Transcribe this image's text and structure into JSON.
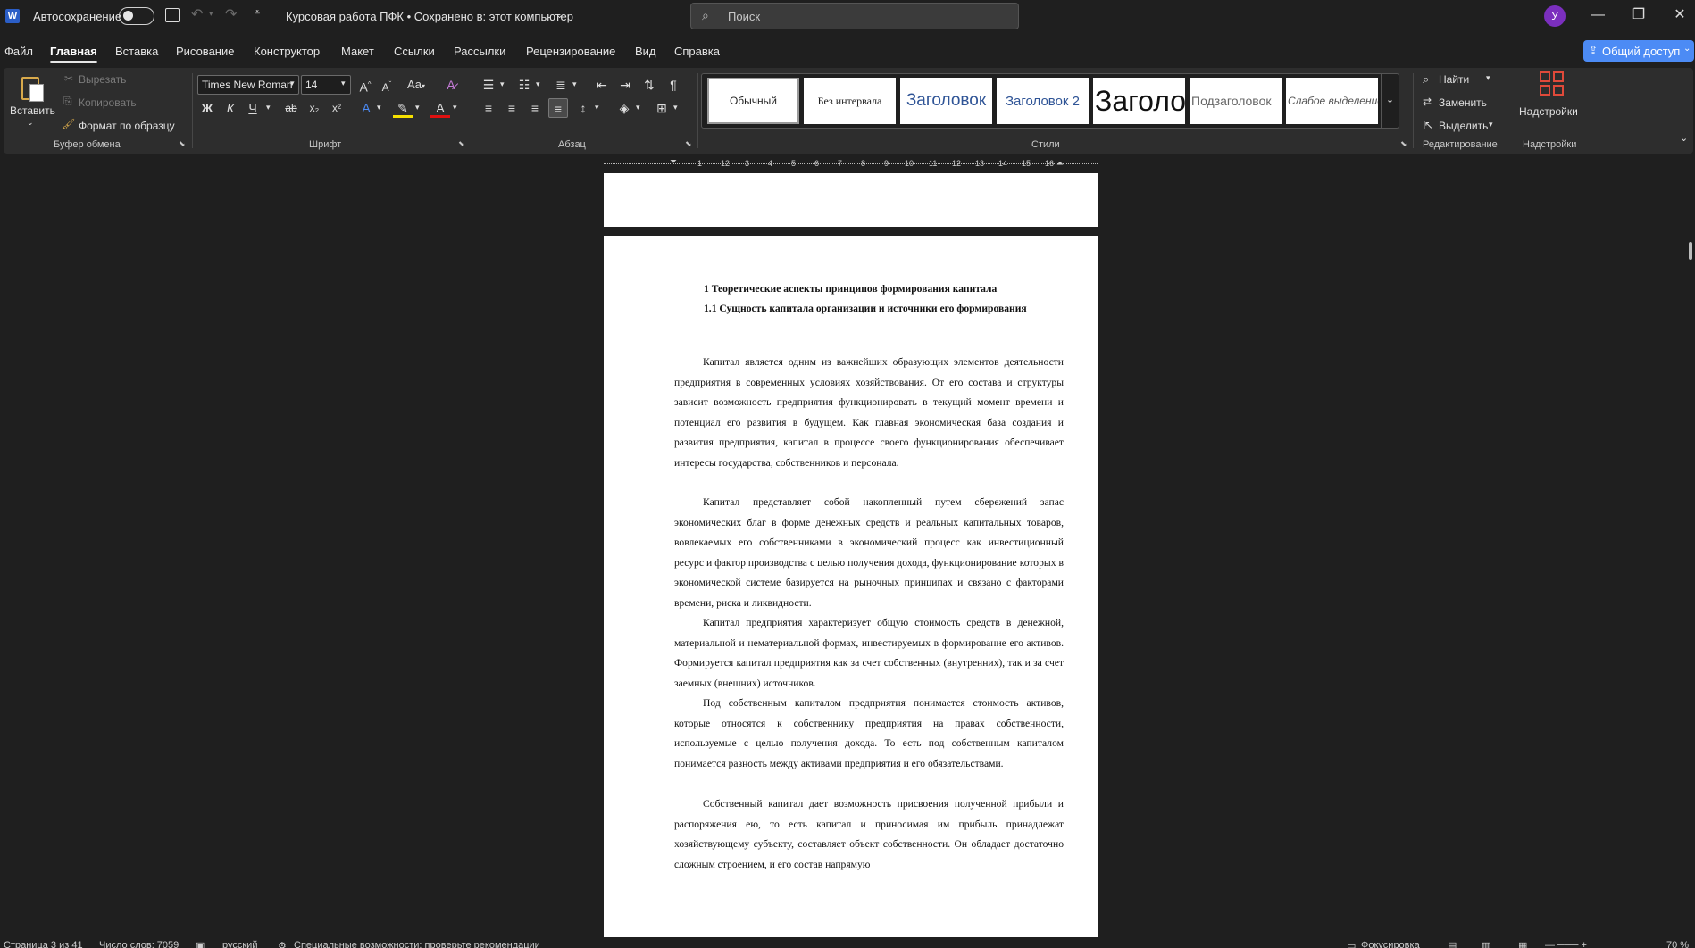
{
  "titlebar": {
    "app_icon": "word-logo-icon",
    "autosave_label": "Автосохранение",
    "document_title": "Курсовая работа ПФК • Сохранено в: этот компьютер",
    "search_placeholder": "Поиск",
    "user_initial": "У"
  },
  "menu": {
    "tabs": [
      "Файл",
      "Главная",
      "Вставка",
      "Рисование",
      "Конструктор",
      "Макет",
      "Ссылки",
      "Рассылки",
      "Рецензирование",
      "Вид",
      "Справка"
    ],
    "active_tab": "Главная",
    "share_label": "Общий доступ"
  },
  "ribbon": {
    "clipboard": {
      "paste": "Вставить",
      "cut": "Вырезать",
      "copy": "Копировать",
      "format_painter": "Формат по образцу",
      "group_label": "Буфер обмена"
    },
    "font": {
      "font_name": "Times New Roman",
      "font_size": "14",
      "change_case": "Aa",
      "bold": "Ж",
      "italic": "К",
      "underline": "Ч",
      "strike": "ab",
      "subscript": "x₂",
      "superscript": "x²",
      "group_label": "Шрифт"
    },
    "paragraph": {
      "group_label": "Абзац"
    },
    "styles": {
      "items": [
        "Обычный",
        "Без интервала",
        "Заголовок",
        "Заголовок 2",
        "Заголовок",
        "Подзаголовок",
        "Слабое выделение"
      ],
      "group_label": "Стили"
    },
    "editing": {
      "find": "Найти",
      "replace": "Заменить",
      "select": "Выделить",
      "group_label": "Редактирование"
    },
    "addins": {
      "label": "Надстройки",
      "group_label": "Надстройки"
    }
  },
  "ruler": {
    "numbers": [
      "1",
      "1",
      "2",
      "3",
      "4",
      "5",
      "6",
      "7",
      "8",
      "9",
      "10",
      "11",
      "12",
      "13",
      "14",
      "15",
      "16"
    ]
  },
  "document": {
    "heading1": "1 Теоретические аспекты принципов формирования капитала",
    "heading2": "1.1 Сущность капитала организации и источники его формирования",
    "paragraphs": [
      "Капитал является одним из важнейших образующих элементов деятельности предприятия в современных условиях хозяйствования. От его состава и структуры зависит возможность предприятия функционировать в текущий момент времени и потенциал его развития в будущем. Как главная экономическая база создания и развития предприятия, капитал в процессе своего функционирования обеспечивает интересы государства, собственников и персонала.",
      "Капитал представляет собой накопленный путем сбережений запас экономических благ в форме денежных средств и реальных капитальных товаров, вовлекаемых его собственниками в экономический процесс как инвестиционный ресурс и фактор производства с целью получения дохода, функционирование которых в экономической системе базируется на рыночных принципах и связано с факторами времени, риска и ликвидности.",
      "Капитал предприятия характеризует общую стоимость средств в денежной, материальной и нематериальной формах, инвестируемых в формирование его активов. Формируется капитал предприятия как за счет собственных (внутренних), так и за счет заемных (внешних) источников.",
      "Под собственным капиталом предприятия понимается стоимость активов, которые относятся к собственнику предприятия на правах собственности, используемые с целью получения дохода. То есть под собственным капиталом понимается разность между активами предприятия и его обязательствами.",
      "Собственный капитал дает возможность присвоения полученной прибыли и распоряжения ею, то есть капитал и приносимая им прибыль принадлежат хозяйствующему субъекту, составляет объект собственности. Он обладает достаточно сложным строением, и его состав напрямую"
    ]
  },
  "statusbar": {
    "page": "Страница 3 из 41",
    "words": "Число слов: 7059",
    "language": "русский",
    "accessibility": "Специальные возможности: проверьте рекомендации",
    "focus": "Фокусировка",
    "zoom": "70 %"
  },
  "colors": {
    "background": "#1f1f1f",
    "ribbon": "#2d2d2d",
    "accent": "#4c8bf5",
    "avatar": "#7b2fbe",
    "page": "#ffffff"
  }
}
